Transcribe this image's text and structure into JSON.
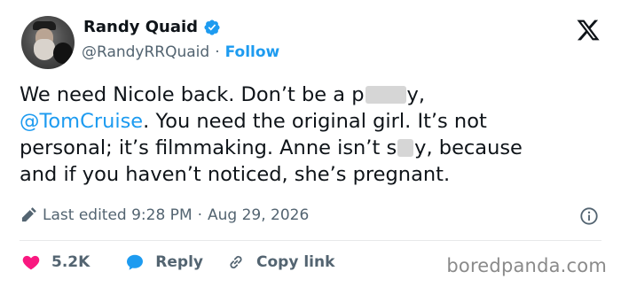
{
  "author": {
    "name": "Randy Quaid",
    "handle": "@RandyRRQuaid",
    "separator": "·",
    "follow_label": "Follow"
  },
  "tweet": {
    "line1_prefix": "We need Nicole back. Don’t be a p",
    "line1_suffix": "y,",
    "mention": "@TomCruise",
    "line2_rest": ". You need the original girl. It’s not",
    "line3": "personal; it’s filmmaking. Anne isn’t s",
    "line3_suffix": "y, because",
    "line4": "and if you haven’t noticed, she’s pregnant."
  },
  "meta": {
    "edited_label": "Last edited 9:28 PM",
    "separator": "·",
    "date": "Aug 29, 2026"
  },
  "actions": {
    "likes": "5.2K",
    "reply_label": "Reply",
    "copy_link_label": "Copy link"
  },
  "watermark": "boredpanda.com",
  "icons": {
    "verified": "verified-badge-icon",
    "x_logo": "x-logo-icon",
    "pencil": "pencil-icon",
    "info": "info-icon",
    "heart": "heart-icon",
    "reply": "chat-bubble-icon",
    "link": "link-icon"
  },
  "colors": {
    "accent": "#1d9bf0",
    "like": "#f91880",
    "text": "#0f1419",
    "muted": "#536471"
  }
}
